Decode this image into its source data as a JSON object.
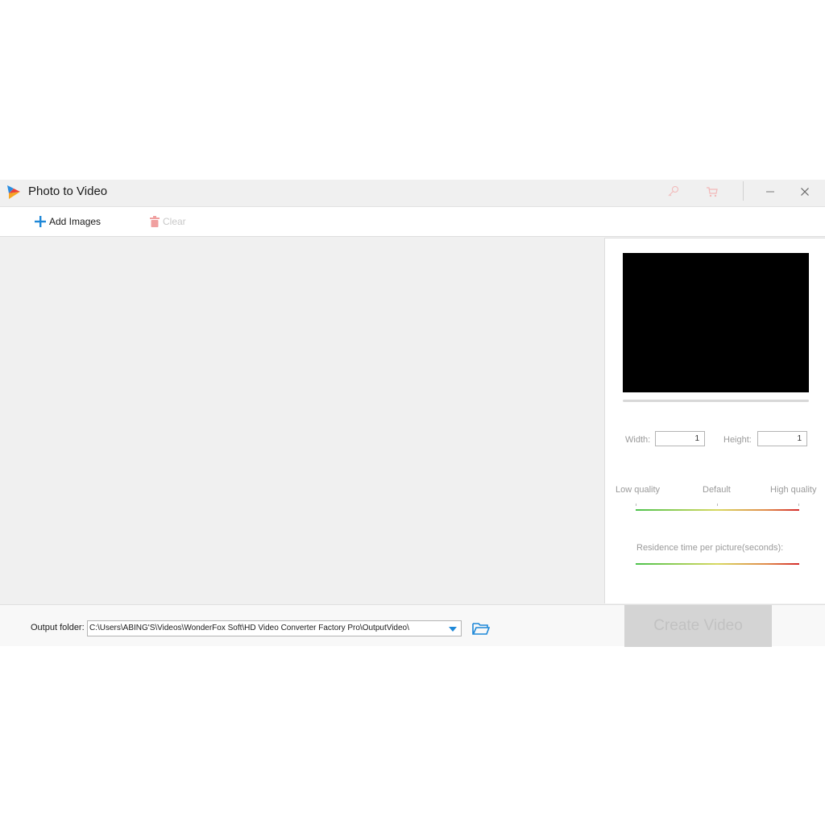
{
  "window": {
    "title": "Photo to Video",
    "icons": {
      "logo": "app-logo-icon",
      "register": "key-icon",
      "buy": "cart-icon",
      "minimize": "minimize-icon",
      "close": "close-icon"
    }
  },
  "toolbar": {
    "add_images_label": "Add Images",
    "clear_label": "Clear"
  },
  "side_panel": {
    "width_label": "Width:",
    "width_value": "1",
    "height_label": "Height:",
    "height_value": "1",
    "quality": {
      "low_label": "Low quality",
      "default_label": "Default",
      "high_label": "High quality"
    },
    "residence_label": "Residence time per picture(seconds):"
  },
  "bottom": {
    "output_folder_label": "Output folder:",
    "output_folder_value": "C:\\Users\\ABING'S\\Videos\\WonderFox Soft\\HD Video Converter Factory Pro\\OutputVideo\\",
    "create_video_label": "Create Video"
  },
  "colors": {
    "accent": "#1e88d8",
    "disabled_icon": "#f0a0a0",
    "preview_bg": "#000000",
    "create_bg": "#d4d4d4"
  }
}
